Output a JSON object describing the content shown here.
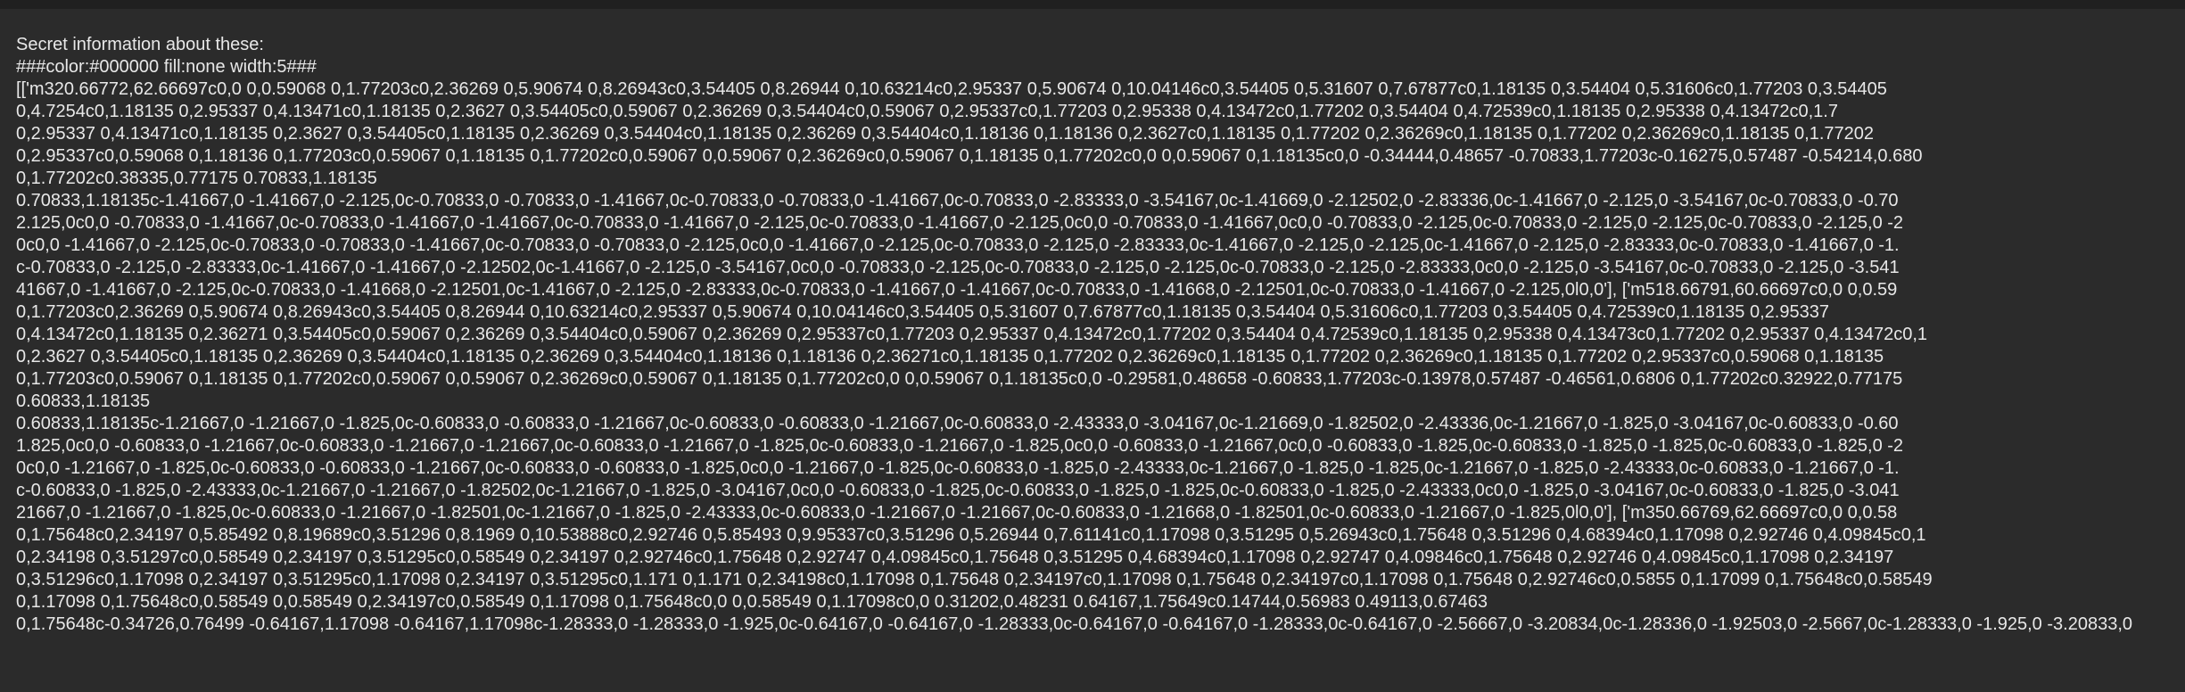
{
  "message": {
    "lines": [
      "Secret information about these:",
      "###color:#000000 fill:none width:5###",
      "[['m320.66772,62.66697c0,0 0,0.59068 0,1.77203c0,2.36269 0,5.90674 0,8.26943c0,3.54405 0,8.26944 0,10.63214c0,2.95337 0,5.90674 0,10.04146c0,3.54405 0,5.31607 0,7.67877c0,1.18135 0,3.54404 0,5.31606c0,1.77203 0,3.54405",
      "0,4.7254c0,1.18135 0,2.95337 0,4.13471c0,1.18135 0,2.3627 0,3.54405c0,0.59067 0,2.36269 0,3.54404c0,0.59067 0,2.95337c0,1.77203 0,2.95338 0,4.13472c0,1.77202 0,3.54404 0,4.72539c0,1.18135 0,2.95338 0,4.13472c0,1.7",
      "0,2.95337 0,4.13471c0,1.18135 0,2.3627 0,3.54405c0,1.18135 0,2.36269 0,3.54404c0,1.18135 0,2.36269 0,3.54404c0,1.18136 0,1.18136 0,2.3627c0,1.18135 0,1.77202 0,2.36269c0,1.18135 0,1.77202 0,2.36269c0,1.18135 0,1.77202",
      "0,2.95337c0,0.59068 0,1.18136 0,1.77203c0,0.59067 0,1.18135 0,1.77202c0,0.59067 0,0.59067 0,2.36269c0,0.59067 0,1.18135 0,1.77202c0,0 0,0.59067 0,1.18135c0,0 -0.34444,0.48657 -0.70833,1.77203c-0.16275,0.57487 -0.54214,0.680",
      "0,1.77202c0.38335,0.77175 0.70833,1.18135",
      "0.70833,1.18135c-1.41667,0 -1.41667,0 -2.125,0c-0.70833,0 -0.70833,0 -1.41667,0c-0.70833,0 -0.70833,0 -1.41667,0c-0.70833,0 -2.83333,0 -3.54167,0c-1.41669,0 -2.12502,0 -2.83336,0c-1.41667,0 -2.125,0 -3.54167,0c-0.70833,0 -0.70",
      "2.125,0c0,0 -0.70833,0 -1.41667,0c-0.70833,0 -1.41667,0 -1.41667,0c-0.70833,0 -1.41667,0 -2.125,0c-0.70833,0 -1.41667,0 -2.125,0c0,0 -0.70833,0 -1.41667,0c0,0 -0.70833,0 -2.125,0c-0.70833,0 -2.125,0 -2.125,0c-0.70833,0 -2.125,0 -2",
      "0c0,0 -1.41667,0 -2.125,0c-0.70833,0 -0.70833,0 -1.41667,0c-0.70833,0 -0.70833,0 -2.125,0c0,0 -1.41667,0 -2.125,0c-0.70833,0 -2.125,0 -2.83333,0c-1.41667,0 -2.125,0 -2.125,0c-1.41667,0 -2.125,0 -2.83333,0c-0.70833,0 -1.41667,0 -1.",
      "c-0.70833,0 -2.125,0 -2.83333,0c-1.41667,0 -1.41667,0 -2.12502,0c-1.41667,0 -2.125,0 -3.54167,0c0,0 -0.70833,0 -2.125,0c-0.70833,0 -2.125,0 -2.125,0c-0.70833,0 -2.125,0 -2.83333,0c0,0 -2.125,0 -3.54167,0c-0.70833,0 -2.125,0 -3.541",
      "41667,0 -1.41667,0 -2.125,0c-0.70833,0 -1.41668,0 -2.12501,0c-1.41667,0 -2.125,0 -2.83333,0c-0.70833,0 -1.41667,0 -1.41667,0c-0.70833,0 -1.41668,0 -2.12501,0c-0.70833,0 -1.41667,0 -2.125,0l0,0'], ['m518.66791,60.66697c0,0 0,0.59",
      "0,1.77203c0,2.36269 0,5.90674 0,8.26943c0,3.54405 0,8.26944 0,10.63214c0,2.95337 0,5.90674 0,10.04146c0,3.54405 0,5.31607 0,7.67877c0,1.18135 0,3.54404 0,5.31606c0,1.77203 0,3.54405 0,4.72539c0,1.18135 0,2.95337",
      "0,4.13472c0,1.18135 0,2.36271 0,3.54405c0,0.59067 0,2.36269 0,3.54404c0,0.59067 0,2.36269 0,2.95337c0,1.77203 0,2.95337 0,4.13472c0,1.77202 0,3.54404 0,4.72539c0,1.18135 0,2.95338 0,4.13473c0,1.77202 0,2.95337 0,4.13472c0,1",
      "0,2.3627 0,3.54405c0,1.18135 0,2.36269 0,3.54404c0,1.18135 0,2.36269 0,3.54404c0,1.18136 0,1.18136 0,2.36271c0,1.18135 0,1.77202 0,2.36269c0,1.18135 0,1.77202 0,2.36269c0,1.18135 0,1.77202 0,2.95337c0,0.59068 0,1.18135",
      "0,1.77203c0,0.59067 0,1.18135 0,1.77202c0,0.59067 0,0.59067 0,2.36269c0,0.59067 0,1.18135 0,1.77202c0,0 0,0.59067 0,1.18135c0,0 -0.29581,0.48658 -0.60833,1.77203c-0.13978,0.57487 -0.46561,0.6806 0,1.77202c0.32922,0.77175",
      "0.60833,1.18135",
      "0.60833,1.18135c-1.21667,0 -1.21667,0 -1.825,0c-0.60833,0 -0.60833,0 -1.21667,0c-0.60833,0 -0.60833,0 -1.21667,0c-0.60833,0 -2.43333,0 -3.04167,0c-1.21669,0 -1.82502,0 -2.43336,0c-1.21667,0 -1.825,0 -3.04167,0c-0.60833,0 -0.60",
      "1.825,0c0,0 -0.60833,0 -1.21667,0c-0.60833,0 -1.21667,0 -1.21667,0c-0.60833,0 -1.21667,0 -1.825,0c-0.60833,0 -1.21667,0 -1.825,0c0,0 -0.60833,0 -1.21667,0c0,0 -0.60833,0 -1.825,0c-0.60833,0 -1.825,0 -1.825,0c-0.60833,0 -1.825,0 -2",
      "0c0,0 -1.21667,0 -1.825,0c-0.60833,0 -0.60833,0 -1.21667,0c-0.60833,0 -0.60833,0 -1.825,0c0,0 -1.21667,0 -1.825,0c-0.60833,0 -1.825,0 -2.43333,0c-1.21667,0 -1.825,0 -1.825,0c-1.21667,0 -1.825,0 -2.43333,0c-0.60833,0 -1.21667,0 -1.",
      "c-0.60833,0 -1.825,0 -2.43333,0c-1.21667,0 -1.21667,0 -1.82502,0c-1.21667,0 -1.825,0 -3.04167,0c0,0 -0.60833,0 -1.825,0c-0.60833,0 -1.825,0 -1.825,0c-0.60833,0 -1.825,0 -2.43333,0c0,0 -1.825,0 -3.04167,0c-0.60833,0 -1.825,0 -3.041",
      "21667,0 -1.21667,0 -1.825,0c-0.60833,0 -1.21667,0 -1.82501,0c-1.21667,0 -1.825,0 -2.43333,0c-0.60833,0 -1.21667,0 -1.21667,0c-0.60833,0 -1.21668,0 -1.82501,0c-0.60833,0 -1.21667,0 -1.825,0l0,0'], ['m350.66769,62.66697c0,0 0,0.58",
      "0,1.75648c0,2.34197 0,5.85492 0,8.19689c0,3.51296 0,8.1969 0,10.53888c0,2.92746 0,5.85493 0,9.95337c0,3.51296 0,5.26944 0,7.61141c0,1.17098 0,3.51295 0,5.26943c0,1.75648 0,3.51296 0,4.68394c0,1.17098 0,2.92746 0,4.09845c0,1",
      "0,2.34198 0,3.51297c0,0.58549 0,2.34197 0,3.51295c0,0.58549 0,2.34197 0,2.92746c0,1.75648 0,2.92747 0,4.09845c0,1.75648 0,3.51295 0,4.68394c0,1.17098 0,2.92747 0,4.09846c0,1.75648 0,2.92746 0,4.09845c0,1.17098 0,2.34197",
      "0,3.51296c0,1.17098 0,2.34197 0,3.51295c0,1.17098 0,2.34197 0,3.51295c0,1.171 0,1.171 0,2.34198c0,1.17098 0,1.75648 0,2.34197c0,1.17098 0,1.75648 0,2.34197c0,1.17098 0,1.75648 0,2.92746c0,0.5855 0,1.17099 0,1.75648c0,0.58549",
      "0,1.17098 0,1.75648c0,0.58549 0,0.58549 0,2.34197c0,0.58549 0,1.17098 0,1.75648c0,0 0,0.58549 0,1.17098c0,0 0.31202,0.48231 0.64167,1.75649c0.14744,0.56983 0.49113,0.67463",
      "0,1.75648c-0.34726,0.76499 -0.64167,1.17098 -0.64167,1.17098c-1.28333,0 -1.28333,0 -1.925,0c-0.64167,0 -0.64167,0 -1.28333,0c-0.64167,0 -0.64167,0 -1.28333,0c-0.64167,0 -2.56667,0 -3.20834,0c-1.28336,0 -1.92503,0 -2.5667,0c-1.28333,0 -1.925,0 -3.20833,0"
    ]
  }
}
